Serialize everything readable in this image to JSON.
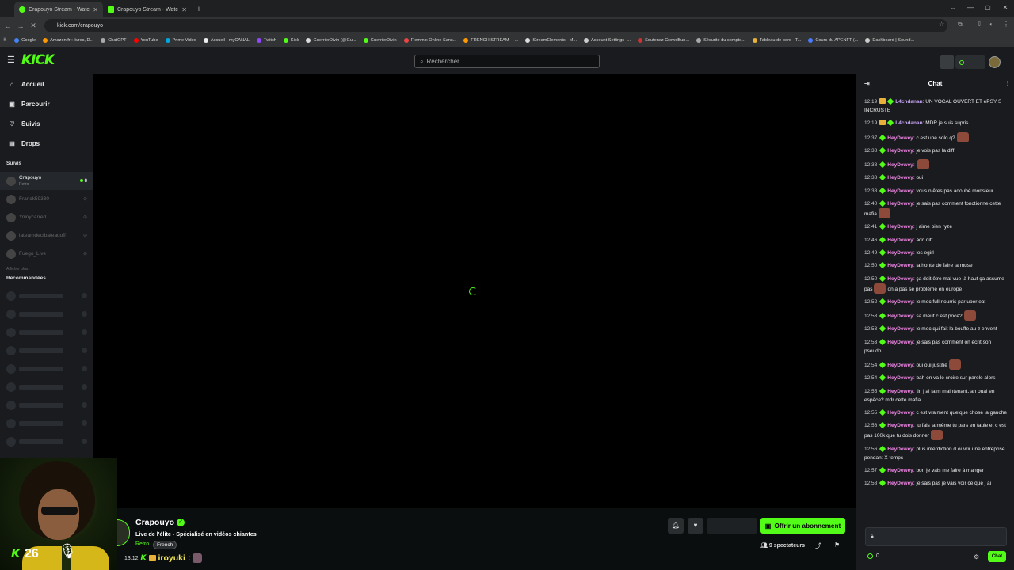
{
  "browser": {
    "tabs": [
      {
        "title": "Crapouyo Stream - Watch Live",
        "active": true
      },
      {
        "title": "Crapouyo Stream - Watch Live",
        "active": false
      }
    ],
    "url": "kick.com/crapouyo",
    "bookmarks": [
      "Google",
      "Amazon.fr : livres, D...",
      "ChatGPT",
      "YouTube",
      "Prime Video",
      "Accueil - myCANAL",
      "Twitch",
      "Kick",
      "GuerrierDivin (@Gu...",
      "GuerrierDivin",
      "Flemmix Online Sans...",
      "FRENCH STREAM —...",
      "StreamElements - M...",
      "Account Settings -...",
      "Soutenez CrowdBun...",
      "Sécurité du compte...",
      "Tableau de bord - T...",
      "Cours du APENFT (...",
      "Dashboard | Sound..."
    ]
  },
  "colors": {
    "accent": "#53fc18",
    "bg": "#0b0e0f",
    "panel": "#191b1f"
  },
  "header": {
    "logo": "KICK",
    "search_placeholder": "Rechercher"
  },
  "sidebar": {
    "nav": [
      {
        "label": "Accueil",
        "icon": "home-icon"
      },
      {
        "label": "Parcourir",
        "icon": "browse-icon"
      },
      {
        "label": "Suivis",
        "icon": "heart-icon"
      },
      {
        "label": "Drops",
        "icon": "drops-icon"
      }
    ],
    "following_title": "Suivis",
    "following": [
      {
        "name": "Crapouyo",
        "category": "Retro",
        "viewers": "8",
        "live": true
      },
      {
        "name": "Franck59330",
        "live": false
      },
      {
        "name": "Yoloycarred",
        "live": false
      },
      {
        "name": "lateamdecfbateauoff",
        "live": false
      },
      {
        "name": "Fuego_Live",
        "live": false
      }
    ],
    "show_more": "Afficher plus",
    "recommended_title": "Recommandées"
  },
  "stream": {
    "streamer": "Crapouyo",
    "title": "Live de l'élite - Spécialisé en vidéos chiantes",
    "category": "Retro",
    "language": "French",
    "webcam_count": "26",
    "subscribe_label": "Offrir un abonnement",
    "viewers_label": "9 spectateurs",
    "last_sub": {
      "time": "13:12",
      "user": "iroyuki",
      "suffix": ":"
    }
  },
  "chat": {
    "title": "Chat",
    "messages": [
      {
        "time": "12:19",
        "user": "L4chdanan",
        "color": "#c7a4f3",
        "text": "UN VOCAL OUVERT ET ePSY S INCRUSTE",
        "crown": true
      },
      {
        "time": "12:19",
        "user": "L4chdanan",
        "color": "#c7a4f3",
        "text": "MDR je suis supris",
        "crown": true
      },
      {
        "time": "12:37",
        "user": "HeyDewey",
        "color": "#f386e6",
        "text": "c est une solo q?",
        "emote": true
      },
      {
        "time": "12:38",
        "user": "HeyDewey",
        "color": "#f386e6",
        "text": "je vois pas la diff"
      },
      {
        "time": "12:38",
        "user": "HeyDewey",
        "color": "#f386e6",
        "text": "",
        "emote": true
      },
      {
        "time": "12:38",
        "user": "HeyDewey",
        "color": "#f386e6",
        "text": "oui"
      },
      {
        "time": "12:38",
        "user": "HeyDewey",
        "color": "#f386e6",
        "text": "vous n êtes pas adoubé monsieur"
      },
      {
        "time": "12:40",
        "user": "HeyDewey",
        "color": "#f386e6",
        "text": "je sais pas comment fonctionne cette mafia",
        "emote": true
      },
      {
        "time": "12:41",
        "user": "HeyDewey",
        "color": "#f386e6",
        "text": "j aime bien ryze"
      },
      {
        "time": "12:46",
        "user": "HeyDewey",
        "color": "#f386e6",
        "text": "adc diff"
      },
      {
        "time": "12:49",
        "user": "HeyDewey",
        "color": "#f386e6",
        "text": "les egirl"
      },
      {
        "time": "12:50",
        "user": "HeyDewey",
        "color": "#f386e6",
        "text": "la honte de faire la muse"
      },
      {
        "time": "12:50",
        "user": "HeyDewey",
        "color": "#f386e6",
        "text": "ça doit être mal vue là haut ça assume pas",
        "emote_mid": true,
        "text2": "on a pas se problème en europe"
      },
      {
        "time": "12:52",
        "user": "HeyDewey",
        "color": "#f386e6",
        "text": "le mec full nourris par uber eat"
      },
      {
        "time": "12:53",
        "user": "HeyDewey",
        "color": "#f386e6",
        "text": "sa meuf c est poce?",
        "emote": true
      },
      {
        "time": "12:53",
        "user": "HeyDewey",
        "color": "#f386e6",
        "text": "le mec qui fait la bouffe au z envent"
      },
      {
        "time": "12:53",
        "user": "HeyDewey",
        "color": "#f386e6",
        "text": "je sais pas comment on écrit son pseudo"
      },
      {
        "time": "12:54",
        "user": "HeyDewey",
        "color": "#f386e6",
        "text": "oui oui justifié",
        "emote": true
      },
      {
        "time": "12:54",
        "user": "HeyDewey",
        "color": "#f386e6",
        "text": "bah on va le croire sur parole alors"
      },
      {
        "time": "12:55",
        "user": "HeyDewey",
        "color": "#f386e6",
        "text": "tin j ai faim maintenant, ah ouai en espèce? mdr cette mafia"
      },
      {
        "time": "12:55",
        "user": "HeyDewey",
        "color": "#f386e6",
        "text": "c est vraiment quelque chose la gauche"
      },
      {
        "time": "12:56",
        "user": "HeyDewey",
        "color": "#f386e6",
        "text": "tu fais la même tu pars en taule et c est pas 100k que tu dois donner",
        "emote": true
      },
      {
        "time": "12:56",
        "user": "HeyDewey",
        "color": "#f386e6",
        "text": "plus interdiction d ouvrir une entreprise pendant X temps"
      },
      {
        "time": "12:57",
        "user": "HeyDewey",
        "color": "#f386e6",
        "text": "bon je vais me faire à manger"
      },
      {
        "time": "12:58",
        "user": "HeyDewey",
        "color": "#f386e6",
        "text": "je sais pas je vais voir ce que j ai"
      }
    ],
    "points": "0",
    "send_label": "Chat"
  }
}
